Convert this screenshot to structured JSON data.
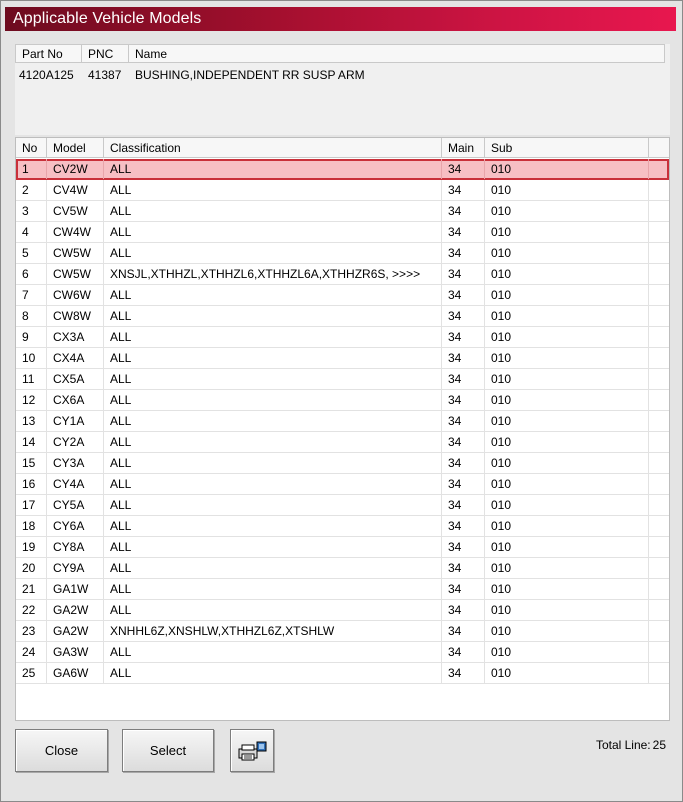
{
  "window": {
    "title": "Applicable Vehicle Models"
  },
  "part": {
    "headers": {
      "part_no": "Part No",
      "pnc": "PNC",
      "name": "Name"
    },
    "part_no": "4120A125",
    "pnc": "41387",
    "name": "BUSHING,INDEPENDENT RR SUSP ARM"
  },
  "list": {
    "headers": {
      "no": "No",
      "model": "Model",
      "classification": "Classification",
      "main": "Main",
      "sub": "Sub"
    },
    "rows": [
      {
        "no": "1",
        "model": "CV2W",
        "classification": "ALL",
        "main": "34",
        "sub": "010"
      },
      {
        "no": "2",
        "model": "CV4W",
        "classification": "ALL",
        "main": "34",
        "sub": "010"
      },
      {
        "no": "3",
        "model": "CV5W",
        "classification": "ALL",
        "main": "34",
        "sub": "010"
      },
      {
        "no": "4",
        "model": "CW4W",
        "classification": "ALL",
        "main": "34",
        "sub": "010"
      },
      {
        "no": "5",
        "model": "CW5W",
        "classification": "ALL",
        "main": "34",
        "sub": "010"
      },
      {
        "no": "6",
        "model": "CW5W",
        "classification": "XNSJL,XTHHZL,XTHHZL6,XTHHZL6A,XTHHZR6S,  >>>>",
        "main": "34",
        "sub": "010"
      },
      {
        "no": "7",
        "model": "CW6W",
        "classification": "ALL",
        "main": "34",
        "sub": "010"
      },
      {
        "no": "8",
        "model": "CW8W",
        "classification": "ALL",
        "main": "34",
        "sub": "010"
      },
      {
        "no": "9",
        "model": "CX3A",
        "classification": "ALL",
        "main": "34",
        "sub": "010"
      },
      {
        "no": "10",
        "model": "CX4A",
        "classification": "ALL",
        "main": "34",
        "sub": "010"
      },
      {
        "no": "11",
        "model": "CX5A",
        "classification": "ALL",
        "main": "34",
        "sub": "010"
      },
      {
        "no": "12",
        "model": "CX6A",
        "classification": "ALL",
        "main": "34",
        "sub": "010"
      },
      {
        "no": "13",
        "model": "CY1A",
        "classification": "ALL",
        "main": "34",
        "sub": "010"
      },
      {
        "no": "14",
        "model": "CY2A",
        "classification": "ALL",
        "main": "34",
        "sub": "010"
      },
      {
        "no": "15",
        "model": "CY3A",
        "classification": "ALL",
        "main": "34",
        "sub": "010"
      },
      {
        "no": "16",
        "model": "CY4A",
        "classification": "ALL",
        "main": "34",
        "sub": "010"
      },
      {
        "no": "17",
        "model": "CY5A",
        "classification": "ALL",
        "main": "34",
        "sub": "010"
      },
      {
        "no": "18",
        "model": "CY6A",
        "classification": "ALL",
        "main": "34",
        "sub": "010"
      },
      {
        "no": "19",
        "model": "CY8A",
        "classification": "ALL",
        "main": "34",
        "sub": "010"
      },
      {
        "no": "20",
        "model": "CY9A",
        "classification": "ALL",
        "main": "34",
        "sub": "010"
      },
      {
        "no": "21",
        "model": "GA1W",
        "classification": "ALL",
        "main": "34",
        "sub": "010"
      },
      {
        "no": "22",
        "model": "GA2W",
        "classification": "ALL",
        "main": "34",
        "sub": "010"
      },
      {
        "no": "23",
        "model": "GA2W",
        "classification": "XNHHL6Z,XNSHLW,XTHHZL6Z,XTSHLW",
        "main": "34",
        "sub": "010"
      },
      {
        "no": "24",
        "model": "GA3W",
        "classification": "ALL",
        "main": "34",
        "sub": "010"
      },
      {
        "no": "25",
        "model": "GA6W",
        "classification": "ALL",
        "main": "34",
        "sub": "010"
      }
    ],
    "selected_index": 0
  },
  "buttons": {
    "close_label": "Close",
    "select_label": "Select",
    "print_icon": "printer-icon"
  },
  "footer": {
    "total_label": "Total Line:",
    "total_value": "25"
  },
  "colors": {
    "title_gradient_start": "#6d0b1f",
    "title_gradient_end": "#e8174f",
    "selected_row_bg": "#f7bfc4",
    "selected_row_border": "#c9303a"
  }
}
